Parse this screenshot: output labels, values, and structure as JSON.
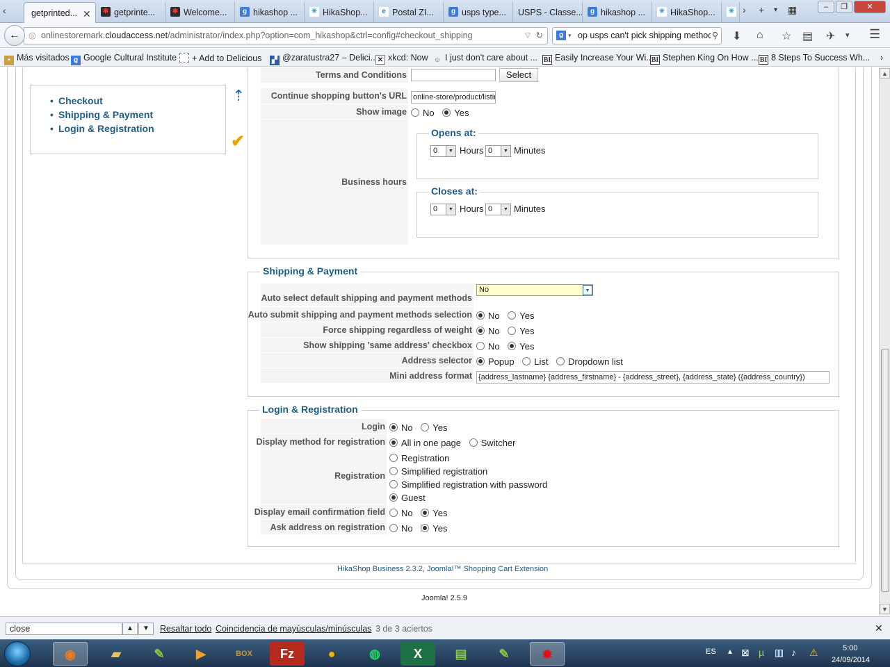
{
  "tabs": [
    {
      "label": "getprinted...",
      "active": true
    },
    {
      "label": "getprinte..."
    },
    {
      "label": "Welcome..."
    },
    {
      "label": "hikashop ..."
    },
    {
      "label": "HikaShop..."
    },
    {
      "label": "Postal ZI..."
    },
    {
      "label": "usps type..."
    },
    {
      "label": "USPS - Classe..."
    },
    {
      "label": "hikashop ..."
    },
    {
      "label": "HikaShop..."
    }
  ],
  "navbar": {
    "url_prefix": "onlinestoremark.",
    "url_domain": "cloudaccess.net",
    "url_path": "/administrator/index.php?option=com_hikashop&ctrl=config#checkout_shipping",
    "search_value": "op usps can't pick shipping method"
  },
  "bookmarks": [
    "Más visitados",
    "Google Cultural Institute",
    "+ Add to Delicious",
    "@zaratustra27 – Delici...",
    "xkcd: Now",
    "I just don't care about ...",
    "Easily Increase Your Wi...",
    "Stephen King On How ...",
    "8 Steps To Success Wh..."
  ],
  "sidemenu": {
    "items": [
      "Checkout",
      "Shipping & Payment",
      "Login & Registration"
    ]
  },
  "checkout": {
    "terms_label": "Terms and Conditions",
    "terms_value": "",
    "select_button": "Select",
    "continue_label": "Continue shopping button's URL",
    "continue_value": "online-store/product/listin",
    "show_image_label": "Show image",
    "no": "No",
    "yes": "Yes",
    "show_image_selected": "Yes",
    "business_hours_label": "Business hours",
    "opens_at": "Opens at:",
    "closes_at": "Closes at:",
    "hours_label": "Hours",
    "minutes_label": "Minutes",
    "open_hours": "0",
    "open_minutes": "0",
    "close_hours": "0",
    "close_minutes": "0"
  },
  "shipping": {
    "legend": "Shipping & Payment",
    "auto_select_label": "Auto select default shipping and payment methods",
    "auto_select_value": "No",
    "auto_submit_label": "Auto submit shipping and payment methods selection",
    "auto_submit_selected": "No",
    "force_shipping_label": "Force shipping regardless of weight",
    "force_shipping_selected": "No",
    "same_address_label": "Show shipping 'same address' checkbox",
    "same_address_selected": "Yes",
    "address_selector_label": "Address selector",
    "address_selector_options": [
      "Popup",
      "List",
      "Dropdown list"
    ],
    "address_selector_selected": "Popup",
    "mini_address_label": "Mini address format",
    "mini_address_value": "{address_lastname} {address_firstname} - {address_street}, {address_state} ({address_country})"
  },
  "login": {
    "legend": "Login & Registration",
    "login_label": "Login",
    "login_selected": "No",
    "display_method_label": "Display method for registration",
    "display_method_options": [
      "All in one page",
      "Switcher"
    ],
    "display_method_selected": "All in one page",
    "registration_label": "Registration",
    "registration_options": [
      "Registration",
      "Simplified registration",
      "Simplified registration with password",
      "Guest"
    ],
    "registration_selected": "Guest",
    "email_confirm_label": "Display email confirmation field",
    "email_confirm_selected": "Yes",
    "ask_address_label": "Ask address on registration",
    "ask_address_selected": "Yes"
  },
  "footer": {
    "hikashop": "HikaShop Business 2.3.2, Joomla!™ Shopping Cart Extension",
    "joomla": "Joomla! 2.5.9"
  },
  "findbar": {
    "query": "close",
    "highlight_all": "Resaltar todo",
    "match_case": "Coincidencia de mayúsculas/minúsculas",
    "result": "3 de 3 aciertos"
  },
  "taskbar": {
    "lang": "ES",
    "time": "5:00",
    "date": "24/09/2014"
  },
  "colors": {
    "legend_blue": "#1d5d88",
    "label_gray": "#555555",
    "select_yellow": "#ffffcc"
  }
}
